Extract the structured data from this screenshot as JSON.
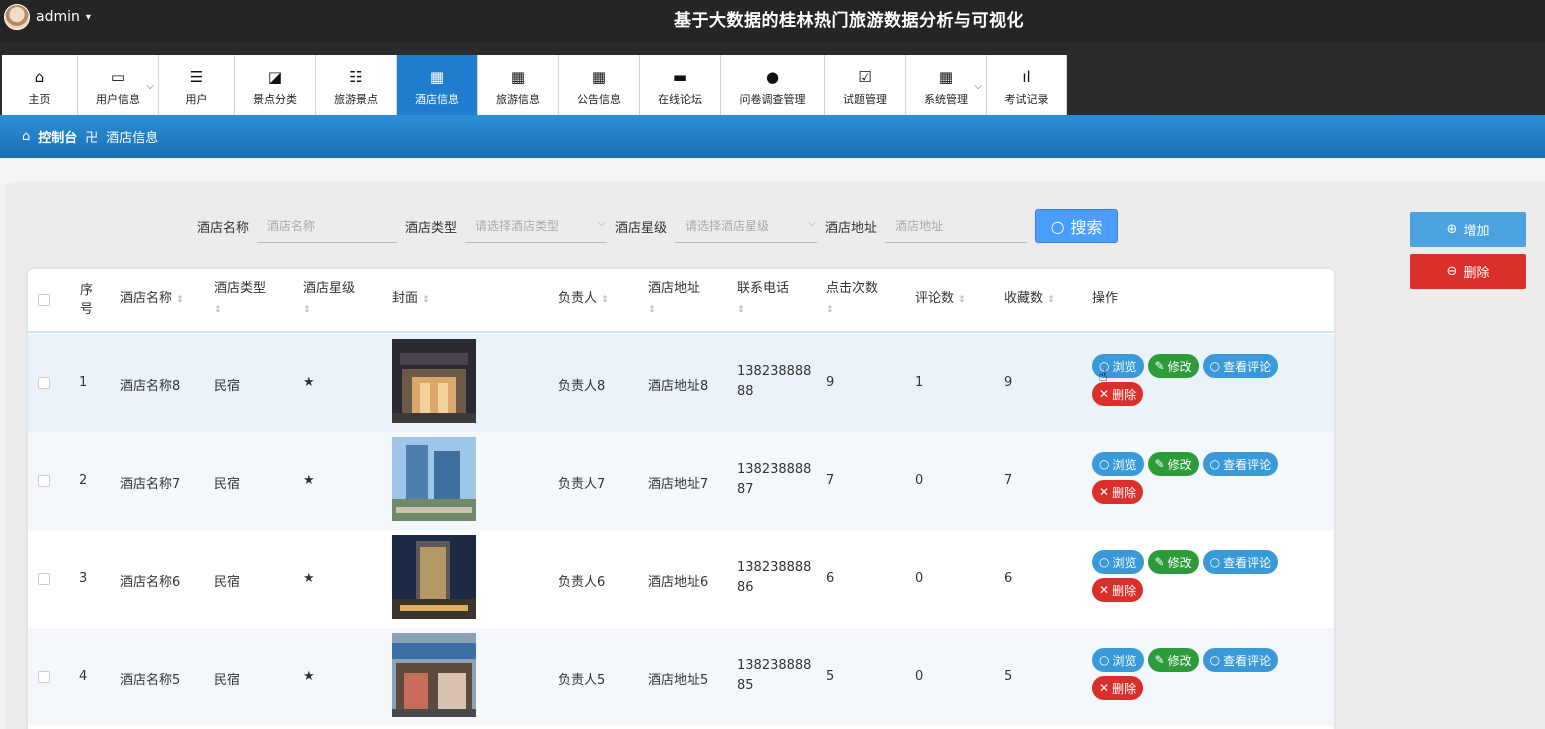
{
  "header": {
    "user": "admin",
    "caret": "▾",
    "title": "基于大数据的桂林热门旅游数据分析与可视化"
  },
  "nav": [
    {
      "label": "主页",
      "icon": "⌂"
    },
    {
      "label": "用户信息",
      "icon": "▭"
    },
    {
      "label": "用户",
      "icon": "☰"
    },
    {
      "label": "景点分类",
      "icon": "◪"
    },
    {
      "label": "旅游景点",
      "icon": "☷"
    },
    {
      "label": "酒店信息",
      "icon": "▦"
    },
    {
      "label": "旅游信息",
      "icon": "▦"
    },
    {
      "label": "公告信息",
      "icon": "▦"
    },
    {
      "label": "在线论坛",
      "icon": "▬"
    },
    {
      "label": "问卷调查管理",
      "icon": "●"
    },
    {
      "label": "试题管理",
      "icon": "☑"
    },
    {
      "label": "系统管理",
      "icon": "▦"
    },
    {
      "label": "考试记录",
      "icon": "ıl"
    }
  ],
  "breadcrumb": {
    "home": "控制台",
    "separator": "卍",
    "current": "酒店信息"
  },
  "search": {
    "name_label": "酒店名称",
    "name_placeholder": "酒店名称",
    "type_label": "酒店类型",
    "type_placeholder": "请选择酒店类型",
    "star_label": "酒店星级",
    "star_placeholder": "请选择酒店星级",
    "addr_label": "酒店地址",
    "addr_placeholder": "酒店地址",
    "button": "搜索"
  },
  "actions": {
    "add": "增加",
    "delete": "删除"
  },
  "table": {
    "headers": {
      "index": "序号",
      "name": "酒店名称",
      "type": "酒店类型",
      "star": "酒店星级",
      "cover": "封面",
      "owner": "负责人",
      "address": "酒店地址",
      "phone": "联系电话",
      "clicks": "点击次数",
      "comments": "评论数",
      "favorites": "收藏数",
      "ops": "操作"
    },
    "row_buttons": {
      "view": "浏览",
      "edit": "修改",
      "comments": "查看评论",
      "delete": "删除"
    },
    "rows": [
      {
        "index": "1",
        "name": "酒店名称8",
        "type": "民宿",
        "star": "★",
        "owner": "负责人8",
        "address": "酒店地址8",
        "phone": "138238888 88",
        "clicks": "9",
        "comments": "1",
        "favorites": "9"
      },
      {
        "index": "2",
        "name": "酒店名称7",
        "type": "民宿",
        "star": "★",
        "owner": "负责人7",
        "address": "酒店地址7",
        "phone": "138238888 87",
        "clicks": "7",
        "comments": "0",
        "favorites": "7"
      },
      {
        "index": "3",
        "name": "酒店名称6",
        "type": "民宿",
        "star": "★",
        "owner": "负责人6",
        "address": "酒店地址6",
        "phone": "138238888 86",
        "clicks": "6",
        "comments": "0",
        "favorites": "6"
      },
      {
        "index": "4",
        "name": "酒店名称5",
        "type": "民宿",
        "star": "★",
        "owner": "负责人5",
        "address": "酒店地址5",
        "phone": "138238888 85",
        "clicks": "5",
        "comments": "0",
        "favorites": "5"
      }
    ]
  }
}
